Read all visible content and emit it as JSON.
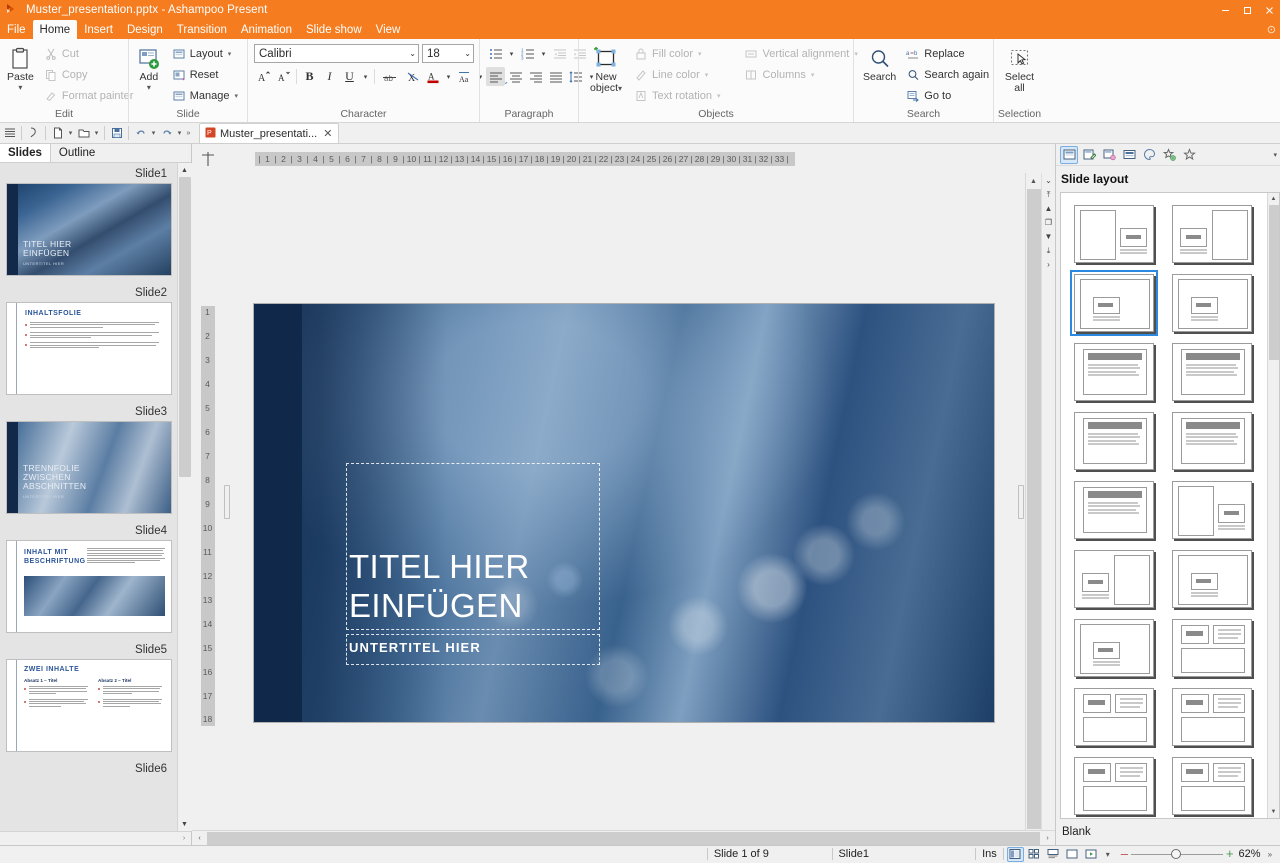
{
  "window": {
    "title": "Muster_presentation.pptx - Ashampoo Present",
    "minimize": "–",
    "maximize": "□",
    "close": "✕"
  },
  "menubar": {
    "items": [
      "File",
      "Home",
      "Insert",
      "Design",
      "Transition",
      "Animation",
      "Slide show",
      "View"
    ],
    "active": "Home"
  },
  "ribbon": {
    "groups": [
      {
        "name": "Edit",
        "title": "Edit",
        "big": {
          "label": "Paste",
          "caret": "▾",
          "icon": "clipboard-icon"
        },
        "small": [
          {
            "label": "Cut",
            "icon": "scissors-icon",
            "disabled": true
          },
          {
            "label": "Copy",
            "icon": "copy-icon",
            "disabled": true
          },
          {
            "label": "Format painter",
            "icon": "brush-icon",
            "disabled": true
          }
        ]
      },
      {
        "name": "Slide",
        "title": "Slide",
        "big": {
          "label": "Add",
          "caret": "▾",
          "icon": "add-slide-icon"
        },
        "small": [
          {
            "label": "Layout",
            "icon": "layout-icon",
            "caret": "▾"
          },
          {
            "label": "Reset",
            "icon": "reset-icon"
          },
          {
            "label": "Manage",
            "icon": "manage-icon",
            "caret": "▾"
          }
        ]
      },
      {
        "name": "Character",
        "title": "Character",
        "font_name": "Calibri",
        "font_size": "18"
      },
      {
        "name": "Paragraph",
        "title": "Paragraph"
      },
      {
        "name": "Objects",
        "title": "Objects",
        "big": {
          "label_line1": "New",
          "label_line2": "object",
          "caret": "▾",
          "icon": "new-object-icon"
        },
        "small_col1": [
          {
            "label": "Fill color",
            "icon": "fill-color-icon",
            "caret": "▾",
            "disabled": true
          },
          {
            "label": "Line color",
            "icon": "line-color-icon",
            "caret": "▾",
            "disabled": true
          },
          {
            "label": "Text rotation",
            "icon": "text-rotation-icon",
            "caret": "▾",
            "disabled": true
          }
        ],
        "small_col2": [
          {
            "label": "Vertical alignment",
            "icon": "vertical-alignment-icon",
            "caret": "▾",
            "disabled": true
          },
          {
            "label": "Columns",
            "icon": "columns-icon",
            "caret": "▾",
            "disabled": true
          }
        ]
      },
      {
        "name": "Search",
        "title": "Search",
        "big": {
          "label": "Search",
          "icon": "magnifier-icon"
        },
        "small": [
          {
            "label": "Replace",
            "icon": "replace-icon"
          },
          {
            "label": "Search again",
            "icon": "search-again-icon"
          },
          {
            "label": "Go to",
            "icon": "goto-icon"
          }
        ]
      },
      {
        "name": "Selection",
        "title": "Selection",
        "big": {
          "label_line1": "Select",
          "label_line2": "all",
          "icon": "select-all-icon"
        }
      }
    ]
  },
  "quickbar": {
    "buttons": [
      "sidebar-icon",
      "pointer-icon",
      "new-doc-icon",
      "open-folder-icon",
      "save-icon",
      "undo-icon",
      "redo-icon"
    ],
    "overflow": "»"
  },
  "doctab": {
    "label": "Muster_presentati...",
    "close": "✕",
    "icon": "pptx-file-icon"
  },
  "left_panel": {
    "tabs": [
      "Slides",
      "Outline"
    ],
    "active_tab": "Slides",
    "slides": [
      {
        "caption": "Slide1",
        "kind": "title",
        "title": "TITEL HIER\nEINFÜGEN",
        "subtitle": "UNTERTITEL HIER"
      },
      {
        "caption": "Slide2",
        "kind": "content",
        "heading": "INHALTSFOLIE",
        "bullets": 3
      },
      {
        "caption": "Slide3",
        "kind": "title",
        "title": "TRENNFOLIE\nZWISCHEN\nABSCHNITTEN",
        "subtitle": "UNTERTITEL HIER"
      },
      {
        "caption": "Slide4",
        "kind": "caption",
        "heading": "INHALT MIT\nBESCHRIFTUNG"
      },
      {
        "caption": "Slide5",
        "kind": "two",
        "heading": "ZWEI INHALTE",
        "col1": "Absatz 1 – Titel",
        "col2": "Absatz 2 – Titel"
      },
      {
        "caption": "Slide6",
        "kind": "partial"
      }
    ]
  },
  "ruler": {
    "horizontal": [
      "1",
      "2",
      "3",
      "4",
      "5",
      "6",
      "7",
      "8",
      "9",
      "10",
      "11",
      "12",
      "13",
      "14",
      "15",
      "16",
      "17",
      "18",
      "19",
      "20",
      "21",
      "22",
      "23",
      "24",
      "25",
      "26",
      "27",
      "28",
      "29",
      "30",
      "31",
      "32",
      "33"
    ],
    "vertical": [
      "1",
      "2",
      "3",
      "4",
      "5",
      "6",
      "7",
      "8",
      "9",
      "10",
      "11",
      "12",
      "13",
      "14",
      "15",
      "16",
      "17",
      "18"
    ]
  },
  "slide": {
    "title": "TITEL HIER\nEINFÜGEN",
    "title_line1": "TITEL HIER",
    "title_line2": "EINFÜGEN",
    "subtitle": "UNTERTITEL HIER"
  },
  "right_panel": {
    "toolbar_icons": [
      "slide-layout-icon",
      "slide-design-icon",
      "slide-transition-icon",
      "slide-master-icon",
      "color-scheme-icon",
      "animation-add-icon",
      "favorite-icon"
    ],
    "toolbar_more": "▾",
    "heading": "Slide layout",
    "footer": "Blank",
    "selected_index": 2,
    "layouts": [
      {
        "id": "pic-left-text-right",
        "type": "split-left"
      },
      {
        "id": "text-left-pic-right",
        "type": "split-right"
      },
      {
        "id": "centered-caption",
        "type": "center-box"
      },
      {
        "id": "centered-caption-2",
        "type": "center-box"
      },
      {
        "id": "title-and-content",
        "type": "title-body"
      },
      {
        "id": "title-and-content-2",
        "type": "title-body"
      },
      {
        "id": "title-and-content-3",
        "type": "title-body"
      },
      {
        "id": "title-and-content-4",
        "type": "title-body"
      },
      {
        "id": "title-and-content-5",
        "type": "title-body"
      },
      {
        "id": "pic-left-text-right-2",
        "type": "split-left"
      },
      {
        "id": "text-left-pic-right-2",
        "type": "split-right"
      },
      {
        "id": "center-box-3",
        "type": "center-box"
      },
      {
        "id": "center-box-4",
        "type": "center-box"
      },
      {
        "id": "two-content-top",
        "type": "two-top"
      },
      {
        "id": "two-content-top-2",
        "type": "two-top"
      },
      {
        "id": "two-content-top-3",
        "type": "two-top"
      },
      {
        "id": "two-content-top-4",
        "type": "two-top"
      },
      {
        "id": "two-content-top-5",
        "type": "two-top"
      }
    ]
  },
  "statusbar": {
    "slide_position": "Slide 1 of 9",
    "layout_name": "Slide1",
    "insert_mode": "Ins",
    "view_icons": [
      "normal-view-icon",
      "slide-sorter-icon",
      "notes-view-icon",
      "reading-view-icon",
      "slideshow-icon"
    ],
    "view_caret": "▾",
    "zoom_minus": "–",
    "zoom_plus": "+",
    "zoom_value": "62%",
    "overflow": "»"
  }
}
